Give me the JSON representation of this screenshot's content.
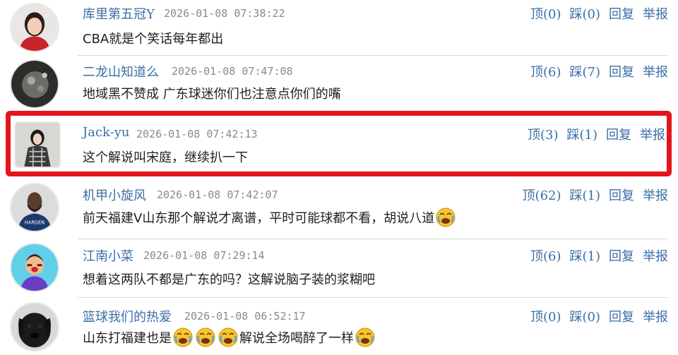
{
  "comments": [
    {
      "username": "库里第五冠Y",
      "time": "2026-01-08 07:38:22",
      "up": "顶(0)",
      "down": "踩(0)",
      "reply": "回复",
      "report": "举报",
      "text": "CBA就是个笑话每年都出",
      "avatar_icon": "avatar-woman-red-icon"
    },
    {
      "username": "二龙山知道么",
      "time": "2026-01-08 07:47:08",
      "up": "顶(6)",
      "down": "踩(7)",
      "reply": "回复",
      "report": "举报",
      "text": "地域黑不赞成 广东球迷你们也注意点你们的嘴",
      "avatar_icon": "avatar-dark-photo-icon"
    },
    {
      "username": "Jack-yu",
      "time": "2026-01-08 07:42:13",
      "up": "顶(3)",
      "down": "踩(1)",
      "reply": "回复",
      "report": "举报",
      "text": "这个解说叫宋庭，继续扒一下",
      "avatar_icon": "avatar-woman-plaid-icon"
    },
    {
      "username": "机甲小旋风",
      "time": "2026-01-08 07:42:07",
      "up": "顶(62)",
      "down": "踩(1)",
      "reply": "回复",
      "report": "举报",
      "text": "前天福建V山东那个解说才离谱，平时可能球都不看，胡说八道",
      "avatar_icon": "avatar-harden-jersey-icon",
      "emojis_after": 1
    },
    {
      "username": "江南小菜",
      "time": "2026-01-08 07:29:14",
      "up": "顶(6)",
      "down": "踩(1)",
      "reply": "回复",
      "report": "举报",
      "text": "想着这两队不都是广东的吗？这解说脑子装的浆糊吧",
      "avatar_icon": "avatar-cartoon-crying-icon"
    },
    {
      "username": "篮球我们的热爱",
      "time": "2026-01-08 06:52:17",
      "up": "顶(0)",
      "down": "踩(0)",
      "reply": "回复",
      "report": "举报",
      "text_part1": "山东打福建也是",
      "text_part2": "解说全场喝醉了一样",
      "avatar_icon": "avatar-black-dog-icon",
      "emoji_icon": "crying-laugh-emoji-icon"
    }
  ],
  "colors": {
    "link": "#3b6ea5",
    "highlight": "#e4141b",
    "time": "#8a8a8a"
  }
}
